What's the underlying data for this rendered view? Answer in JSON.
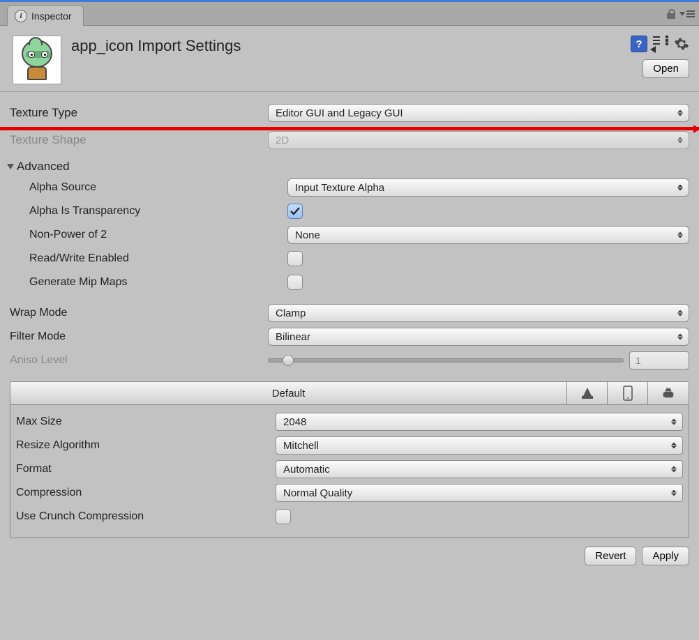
{
  "tab": {
    "label": "Inspector"
  },
  "header": {
    "title": "app_icon Import Settings",
    "open_button": "Open"
  },
  "fields": {
    "texture_type_label": "Texture Type",
    "texture_type_value": "Editor GUI and Legacy GUI",
    "texture_shape_label": "Texture Shape",
    "texture_shape_value": "2D",
    "advanced_label": "Advanced",
    "alpha_source_label": "Alpha Source",
    "alpha_source_value": "Input Texture Alpha",
    "alpha_is_transparency_label": "Alpha Is Transparency",
    "non_power_label": "Non-Power of 2",
    "non_power_value": "None",
    "read_write_label": "Read/Write Enabled",
    "generate_mip_label": "Generate Mip Maps",
    "wrap_mode_label": "Wrap Mode",
    "wrap_mode_value": "Clamp",
    "filter_mode_label": "Filter Mode",
    "filter_mode_value": "Bilinear",
    "aniso_label": "Aniso Level",
    "aniso_value": "1"
  },
  "platform": {
    "default_tab": "Default",
    "max_size_label": "Max Size",
    "max_size_value": "2048",
    "resize_algo_label": "Resize Algorithm",
    "resize_algo_value": "Mitchell",
    "format_label": "Format",
    "format_value": "Automatic",
    "compression_label": "Compression",
    "compression_value": "Normal Quality",
    "crunch_label": "Use Crunch Compression"
  },
  "footer": {
    "revert": "Revert",
    "apply": "Apply"
  }
}
